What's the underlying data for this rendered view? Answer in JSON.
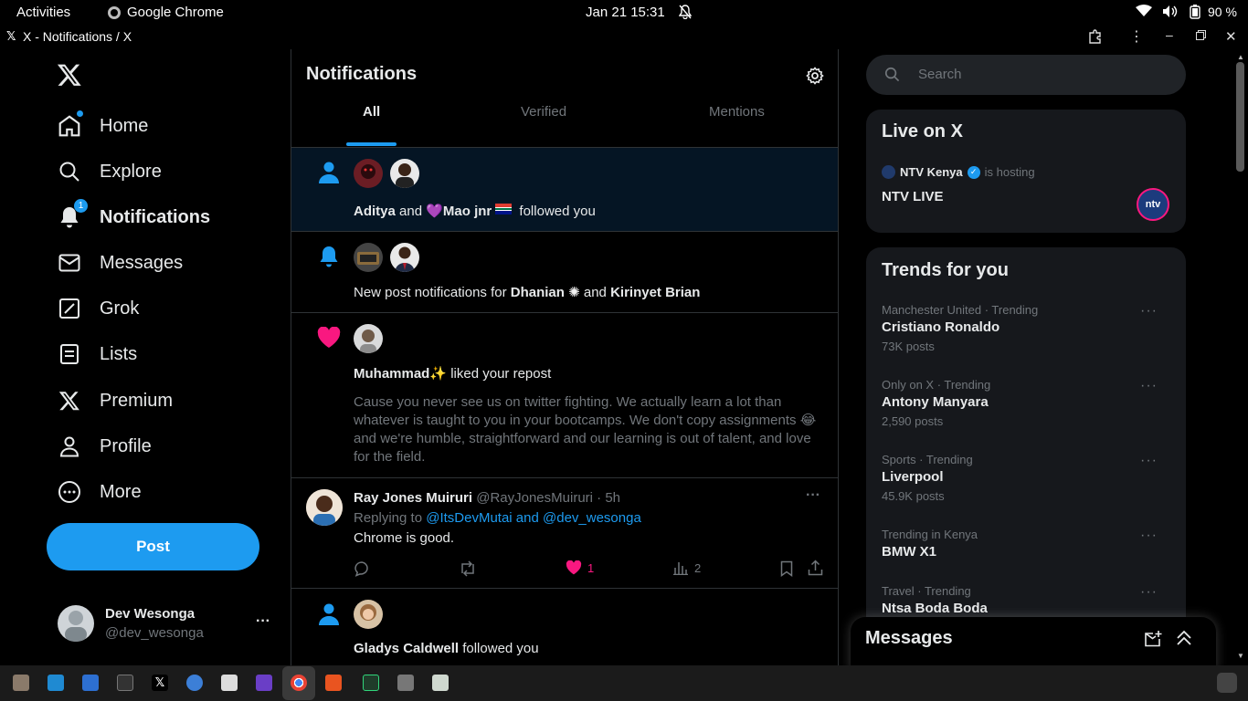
{
  "system_bar": {
    "activities": "Activities",
    "app_name": "Google Chrome",
    "datetime": "Jan 21  15:31",
    "battery": "90 %"
  },
  "window": {
    "title": "X - Notifications / X"
  },
  "nav": {
    "home": "Home",
    "explore": "Explore",
    "notifications": "Notifications",
    "notifications_badge": "1",
    "messages": "Messages",
    "grok": "Grok",
    "lists": "Lists",
    "premium": "Premium",
    "profile": "Profile",
    "more": "More",
    "post_button": "Post",
    "account_name": "Dev Wesonga",
    "account_handle": "@dev_wesonga"
  },
  "main": {
    "header": "Notifications",
    "tabs": [
      "All",
      "Verified",
      "Mentions"
    ],
    "follow1": {
      "name1": "Aditya",
      "and": "and",
      "name2": "Mao jnr",
      "action": "followed you"
    },
    "post_notif": {
      "prefix": "New post notifications for",
      "name1": "Dhanian",
      "and": "and",
      "name2": "Kirinyet Brian"
    },
    "like": {
      "name": "Muhammad",
      "action": "liked your repost",
      "text1": "Cause you never see us on twitter fighting. We actually learn a lot than whatever is taught to you in your bootcamps. We don't copy assignments",
      "text2": "and we're humble, straightforward and our learning is out of talent, and love for the field."
    },
    "reply": {
      "name": "Ray Jones Muiruri",
      "handle": "@RayJonesMuiruri · 5h",
      "replying_prefix": "Replying to",
      "replying_to": "@ItsDevMutai and @dev_wesonga",
      "body": "Chrome is good.",
      "likes": "1",
      "views": "2"
    },
    "follow2": {
      "name": "Gladys Caldwell",
      "action": "followed you"
    }
  },
  "right": {
    "search_placeholder": "Search",
    "live": {
      "title": "Live on X",
      "host": "NTV Kenya",
      "hosting": "is hosting",
      "show": "NTV LIVE"
    },
    "trends": {
      "title": "Trends for you",
      "items": [
        {
          "category": "Manchester United · Trending",
          "name": "Cristiano Ronaldo",
          "count": "73K posts"
        },
        {
          "category": "Only on X · Trending",
          "name": "Antony Manyara",
          "count": "2,590 posts"
        },
        {
          "category": "Sports · Trending",
          "name": "Liverpool",
          "count": "45.9K posts"
        },
        {
          "category": "Trending in Kenya",
          "name": "BMW X1",
          "count": ""
        },
        {
          "category": "Travel · Trending",
          "name": "Ntsa Boda Boda",
          "count": ""
        }
      ]
    },
    "messages_drawer": "Messages"
  },
  "colors": {
    "accent": "#1d9bf0",
    "like": "#f91880",
    "card_bg": "#16181c",
    "border": "#2f3336"
  }
}
